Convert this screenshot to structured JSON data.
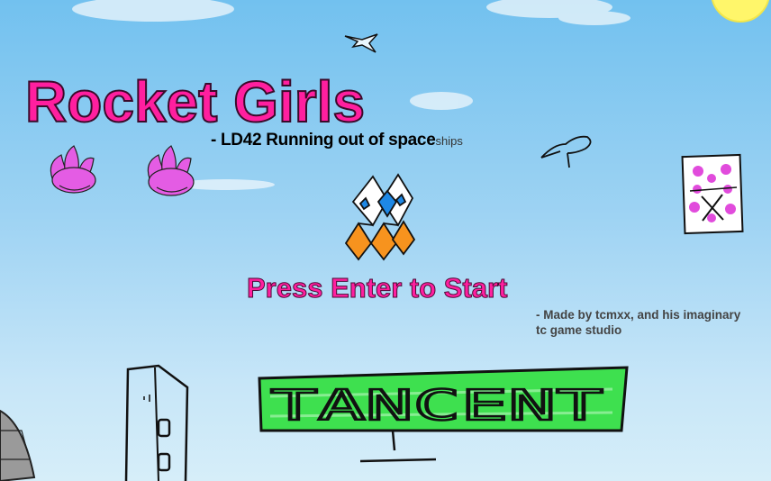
{
  "game": {
    "title": "Rocket Girls",
    "subtitle": "- LD42 Running out of space",
    "subtitle_suffix": "ships",
    "start_prompt": "Press Enter to Start",
    "credits": "- Made by tcmxx, and his imaginary tc game studio",
    "sign_text": "TANCENT"
  },
  "icons": {
    "player_ship": "rocket-ship-icon",
    "lives": [
      "lotus-flower-icon",
      "lotus-flower-icon"
    ],
    "enemy": "dice-face-icon",
    "birds": [
      "bird-icon",
      "bird-icon"
    ],
    "sun": "sun-icon"
  },
  "colors": {
    "accent": "#ff1f9f",
    "sky_top": "#72c1ef",
    "sky_bottom": "#d6eef9",
    "sign_green": "#3ee04f",
    "flame_orange": "#f7931e",
    "wing_blue": "#1e88e5",
    "lotus_purple": "#e45ce4"
  }
}
